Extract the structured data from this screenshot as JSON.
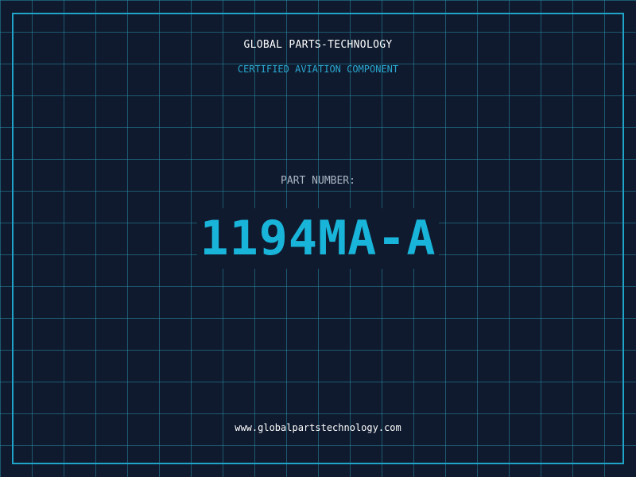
{
  "header": {
    "company": "GLOBAL PARTS-TECHNOLOGY",
    "tagline": "CERTIFIED AVIATION COMPONENT"
  },
  "part": {
    "label": "PART NUMBER:",
    "number": "1194MA-A"
  },
  "footer": {
    "website": "www.globalpartstechnology.com"
  },
  "colors": {
    "background": "#0f1a2e",
    "grid": "#288ca5",
    "accent": "#1fa3c9",
    "part_number": "#19b4d9",
    "label": "#aab5c4",
    "text": "#ffffff"
  }
}
